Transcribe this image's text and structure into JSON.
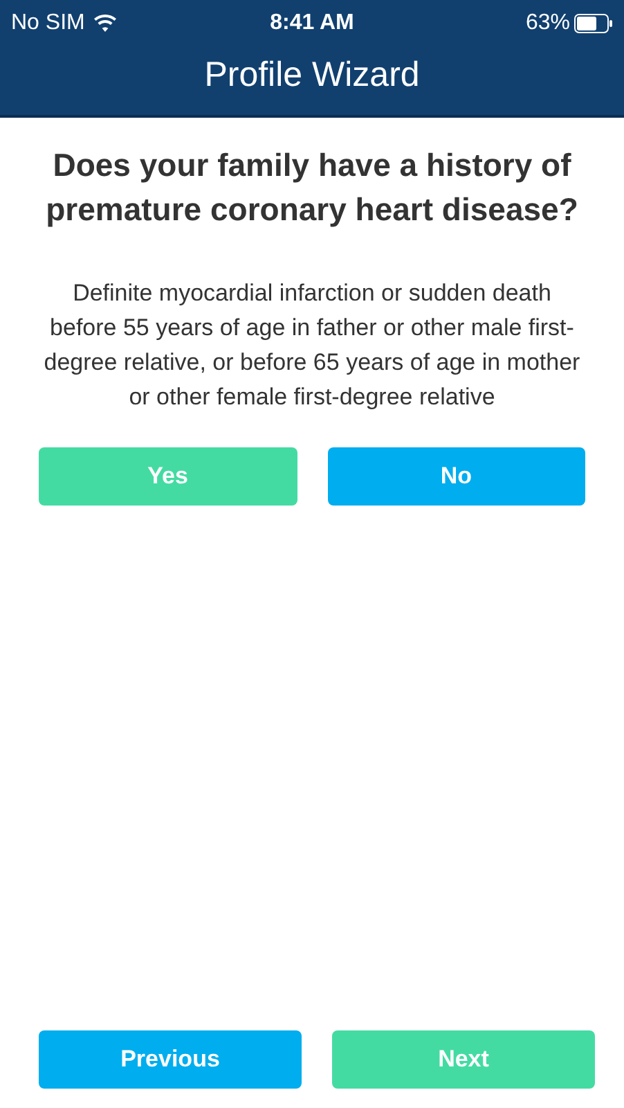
{
  "status_bar": {
    "carrier": "No SIM",
    "time": "8:41 AM",
    "battery": "63%"
  },
  "nav_bar": {
    "title": "Profile Wizard"
  },
  "question": "Does your family have a history of premature coronary heart disease?",
  "description": "Definite myocardial infarction or sudden death before 55 years of age in father or other male first-degree relative, or before 65 years of age in mother or other female first-degree relative",
  "answers": [
    {
      "label": "Yes",
      "color": "#44dba3"
    },
    {
      "label": "No",
      "color": "#00adee"
    }
  ],
  "navigation": [
    {
      "label": "Previous",
      "color": "#00adee"
    },
    {
      "label": "Next",
      "color": "#44dba3"
    }
  ]
}
